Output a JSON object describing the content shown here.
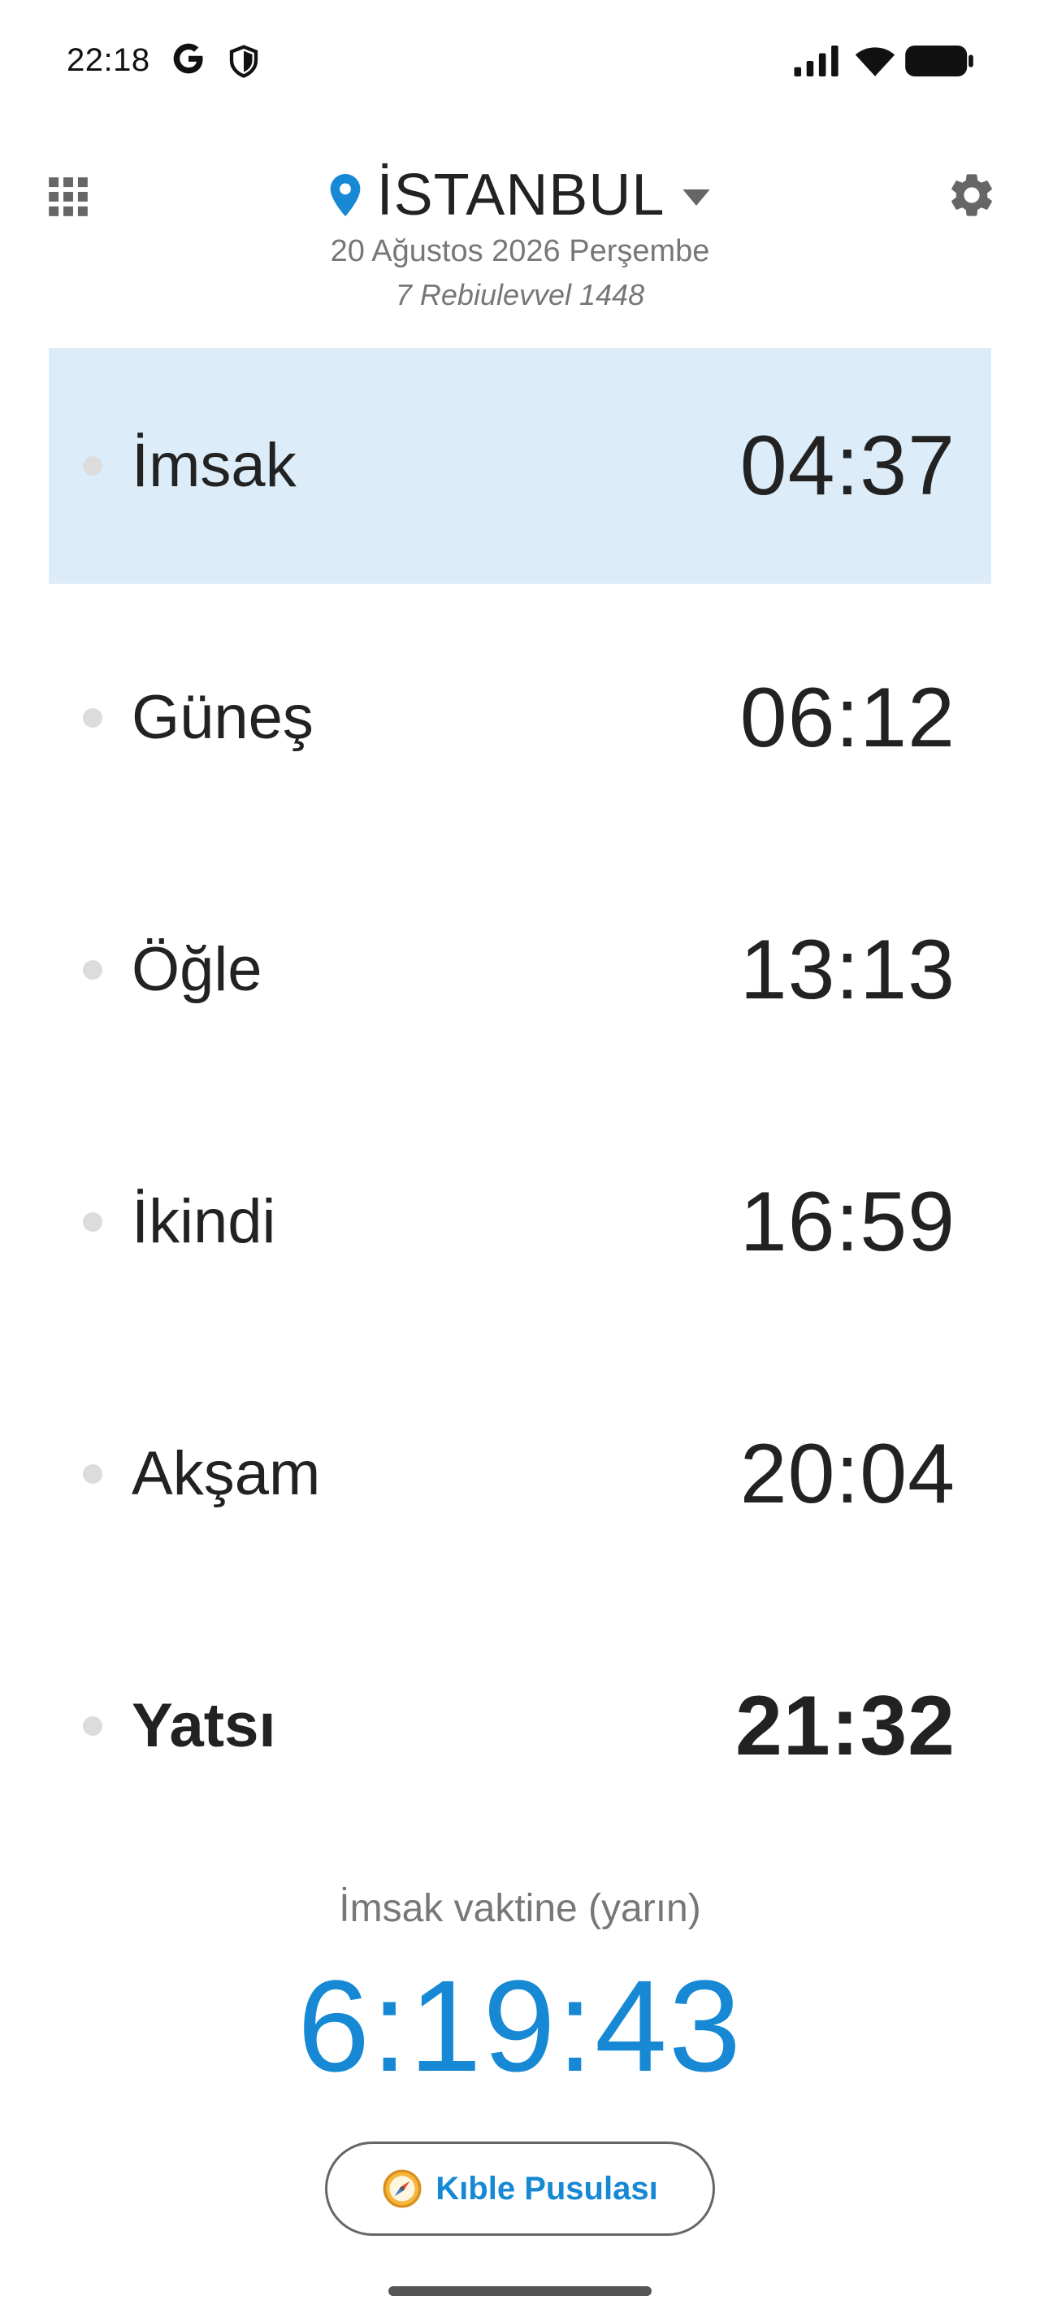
{
  "status_bar": {
    "time": "22:18",
    "icons": [
      "google-icon",
      "shield-icon",
      "signal-icon",
      "wifi-icon",
      "battery-icon"
    ]
  },
  "header": {
    "apps_icon": "grid-apps-icon",
    "city": "İSTANBUL",
    "gregorian_date": "20 Ağustos 2026 Perşembe",
    "hijri_date": "7 Rebiulevvel 1448",
    "settings_icon": "gear-icon"
  },
  "prayers": [
    {
      "name": "İmsak",
      "time": "04:37",
      "highlighted": true
    },
    {
      "name": "Güneş",
      "time": "06:12"
    },
    {
      "name": "Öğle",
      "time": "13:13"
    },
    {
      "name": "İkindi",
      "time": "16:59"
    },
    {
      "name": "Akşam",
      "time": "20:04"
    },
    {
      "name": "Yatsı",
      "time": "21:32",
      "current": true
    }
  ],
  "countdown": {
    "label": "İmsak vaktine (yarın)",
    "value": "6:19:43"
  },
  "qibla_button": {
    "label": "Kıble Pusulası",
    "icon": "compass-icon"
  },
  "colors": {
    "accent": "#1688d4",
    "highlight_bg": "#dcedf9",
    "text": "#222222",
    "muted": "#777777"
  }
}
